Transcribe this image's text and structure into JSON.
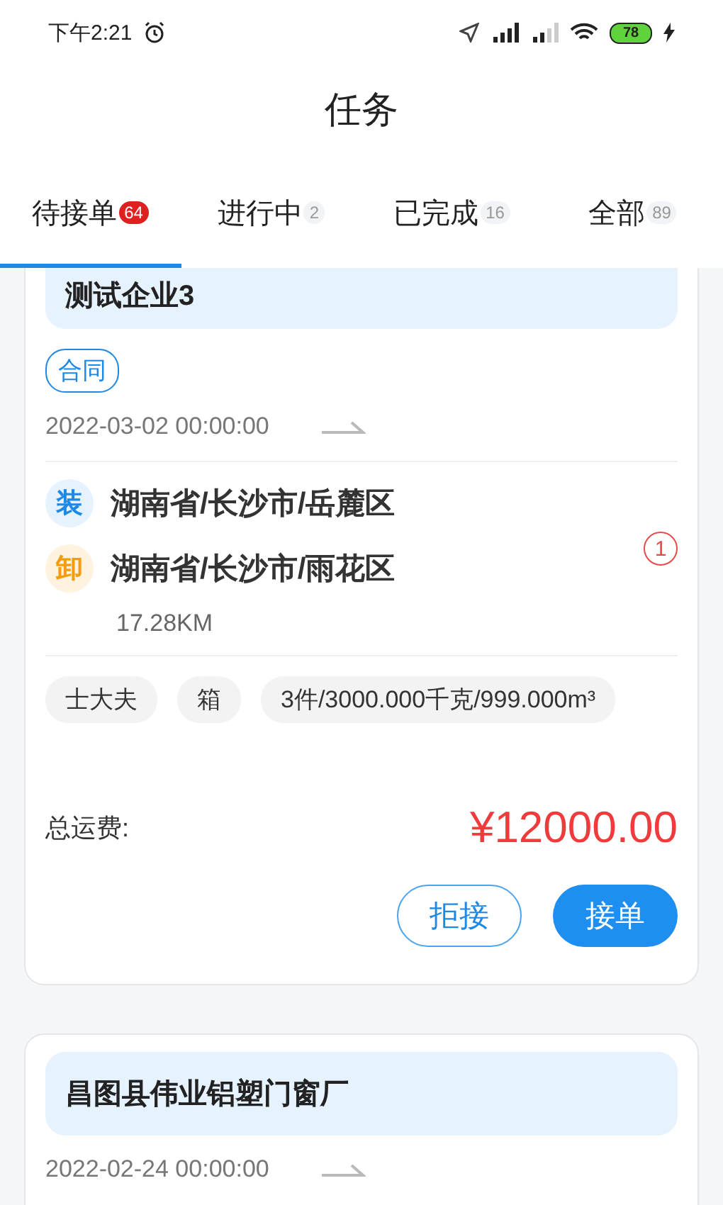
{
  "status_bar": {
    "time": "下午2:21",
    "battery": "78"
  },
  "title": "任务",
  "tabs": [
    {
      "label": "待接单",
      "count": "64",
      "kind": "alert",
      "selected": true
    },
    {
      "label": "进行中",
      "count": "2",
      "kind": "muted",
      "selected": false
    },
    {
      "label": "已完成",
      "count": "16",
      "kind": "muted",
      "selected": false
    },
    {
      "label": "全部",
      "count": "89",
      "kind": "muted",
      "selected": false
    }
  ],
  "orders": [
    {
      "company": "测试企业3",
      "tags": [
        "合同"
      ],
      "date": "2022-03-02 00:00:00",
      "stops": [
        {
          "kind": "load",
          "marker": "装",
          "address": "湖南省/长沙市/岳麓区"
        },
        {
          "kind": "unload",
          "marker": "卸",
          "address": "湖南省/长沙市/雨花区"
        }
      ],
      "stop_count": "1",
      "distance": "17.28KM",
      "goods": [
        "士大夫",
        "箱",
        "3件/3000.000千克/999.000m³"
      ],
      "total_label": "总运费:",
      "total": "¥12000.00",
      "buttons": [
        {
          "label": "拒接",
          "kind": "outline"
        },
        {
          "label": "接单",
          "kind": "primary"
        }
      ]
    },
    {
      "company": "昌图县伟业铝塑门窗厂",
      "date": "2022-02-24 00:00:00"
    }
  ]
}
